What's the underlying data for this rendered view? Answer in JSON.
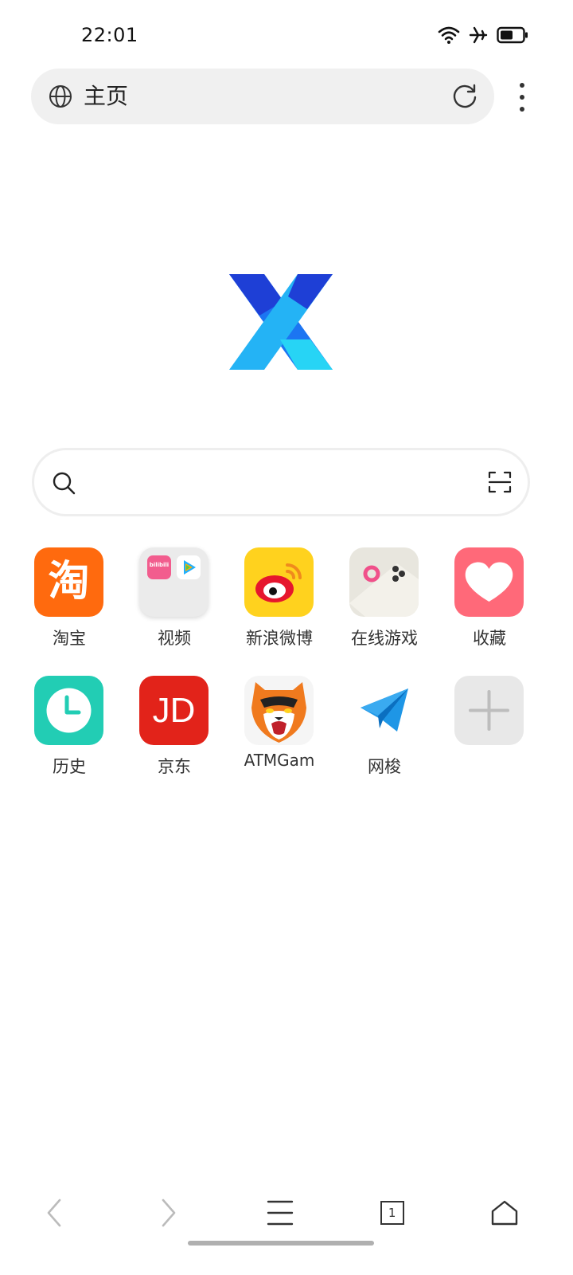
{
  "status_bar": {
    "time": "22:01",
    "icons": [
      "wifi-icon",
      "airplane-icon",
      "battery-icon"
    ]
  },
  "address_bar": {
    "title": "主页",
    "icons": [
      "globe-icon",
      "refresh-icon",
      "more-icon"
    ]
  },
  "logo": {
    "name": "x-browser-logo",
    "colors": [
      "#1E3FD6",
      "#1C75F2",
      "#24B3F5",
      "#27D4F5"
    ]
  },
  "search": {
    "value": "",
    "placeholder": "",
    "icons": [
      "search-icon",
      "scan-icon"
    ]
  },
  "shortcuts": [
    {
      "label": "淘宝",
      "icon": "taobao-icon",
      "tile_text": "淘",
      "color": "#FF6A0E"
    },
    {
      "label": "视频",
      "icon": "video-folder-icon",
      "tile_text": "bilibili",
      "color": "#EBEBEB"
    },
    {
      "label": "新浪微博",
      "icon": "weibo-icon",
      "tile_text": "",
      "color": "#FFD21E"
    },
    {
      "label": "在线游戏",
      "icon": "gamepad-icon",
      "tile_text": "",
      "color": "#E8E6DE"
    },
    {
      "label": "收藏",
      "icon": "heart-icon",
      "tile_text": "",
      "color": "#FF6979"
    },
    {
      "label": "历史",
      "icon": "clock-icon",
      "tile_text": "",
      "color": "#22CDB4"
    },
    {
      "label": "京东",
      "icon": "jd-icon",
      "tile_text": "JD",
      "color": "#E2231A"
    },
    {
      "label": "ATMGam",
      "icon": "tiger-icon",
      "tile_text": "",
      "color": "#F5F5F5"
    },
    {
      "label": "网梭",
      "icon": "paper-plane-icon",
      "tile_text": "",
      "color": "#FFFFFF"
    },
    {
      "label": "",
      "icon": "add-icon",
      "tile_text": "",
      "color": "#E8E8E8"
    }
  ],
  "bottom_nav": {
    "tab_count": "1",
    "icons": [
      "back-icon",
      "forward-icon",
      "menu-icon",
      "tabs-icon",
      "home-icon"
    ]
  }
}
